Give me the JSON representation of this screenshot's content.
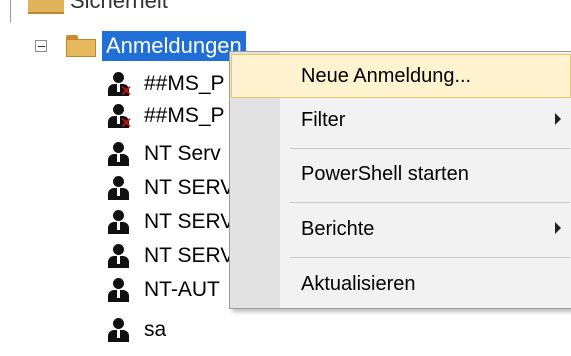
{
  "tree": {
    "parent_partial_label": "Sicherheit",
    "expander_icon": "minus-box-icon",
    "folder_icon": "folder-icon",
    "selected_node": {
      "label": "Anmeldungen"
    },
    "children": [
      {
        "label": "##MS_P",
        "icon": "user-disabled-icon"
      },
      {
        "label": "##MS_P",
        "icon": "user-disabled-icon"
      },
      {
        "label": "NT Serv",
        "icon": "user-icon"
      },
      {
        "label": "NT SERV",
        "icon": "user-icon"
      },
      {
        "label": "NT SERV",
        "icon": "user-icon"
      },
      {
        "label": "NT SERV",
        "icon": "user-icon"
      },
      {
        "label": "NT-AUT",
        "icon": "user-icon"
      },
      {
        "label": "sa",
        "icon": "user-icon"
      }
    ]
  },
  "context_menu": {
    "items": [
      {
        "label": "Neue Anmeldung...",
        "highlighted": true,
        "has_submenu": false
      },
      {
        "label": "Filter",
        "highlighted": false,
        "has_submenu": true
      },
      {
        "label": "PowerShell starten",
        "highlighted": false,
        "has_submenu": false
      },
      {
        "label": "Berichte",
        "highlighted": false,
        "has_submenu": true
      },
      {
        "label": "Aktualisieren",
        "highlighted": false,
        "has_submenu": false
      }
    ]
  },
  "colors": {
    "selection": "#1f6fd6",
    "menu_highlight": "#fff4cf",
    "menu_highlight_border": "#e6c665",
    "menu_background": "#f2f2f2",
    "disabled_mark": "#dd1111"
  }
}
